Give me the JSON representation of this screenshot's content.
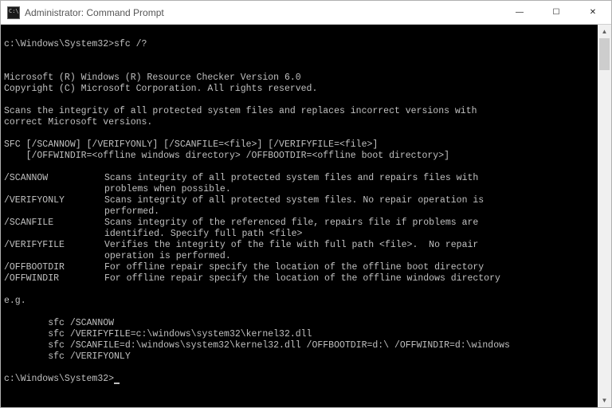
{
  "window": {
    "title": "Administrator: Command Prompt",
    "buttons": {
      "minimize": "—",
      "maximize": "☐",
      "close": "✕"
    }
  },
  "prompt1": {
    "cwd": "c:\\Windows\\System32>",
    "command": "sfc /?"
  },
  "header": {
    "product": "Microsoft (R) Windows (R) Resource Checker Version 6.0",
    "copyright": "Copyright (C) Microsoft Corporation. All rights reserved."
  },
  "description": {
    "line1": "Scans the integrity of all protected system files and replaces incorrect versions with",
    "line2": "correct Microsoft versions."
  },
  "usage": {
    "line1": "SFC [/SCANNOW] [/VERIFYONLY] [/SCANFILE=<file>] [/VERIFYFILE=<file>]",
    "line2": "    [/OFFWINDIR=<offline windows directory> /OFFBOOTDIR=<offline boot directory>]"
  },
  "options": [
    {
      "switch": "/SCANNOW",
      "desc": "Scans integrity of all protected system files and repairs files with\nproblems when possible."
    },
    {
      "switch": "/VERIFYONLY",
      "desc": "Scans integrity of all protected system files. No repair operation is\nperformed."
    },
    {
      "switch": "/SCANFILE",
      "desc": "Scans integrity of the referenced file, repairs file if problems are\nidentified. Specify full path <file>"
    },
    {
      "switch": "/VERIFYFILE",
      "desc": "Verifies the integrity of the file with full path <file>.  No repair\noperation is performed."
    },
    {
      "switch": "/OFFBOOTDIR",
      "desc": "For offline repair specify the location of the offline boot directory"
    },
    {
      "switch": "/OFFWINDIR",
      "desc": "For offline repair specify the location of the offline windows directory"
    }
  ],
  "examples": {
    "heading": "e.g.",
    "lines": [
      "        sfc /SCANNOW",
      "        sfc /VERIFYFILE=c:\\windows\\system32\\kernel32.dll",
      "        sfc /SCANFILE=d:\\windows\\system32\\kernel32.dll /OFFBOOTDIR=d:\\ /OFFWINDIR=d:\\windows",
      "        sfc /VERIFYONLY"
    ]
  },
  "prompt2": {
    "cwd": "c:\\Windows\\System32>"
  },
  "scrollbar": {
    "up": "▲",
    "down": "▼"
  }
}
